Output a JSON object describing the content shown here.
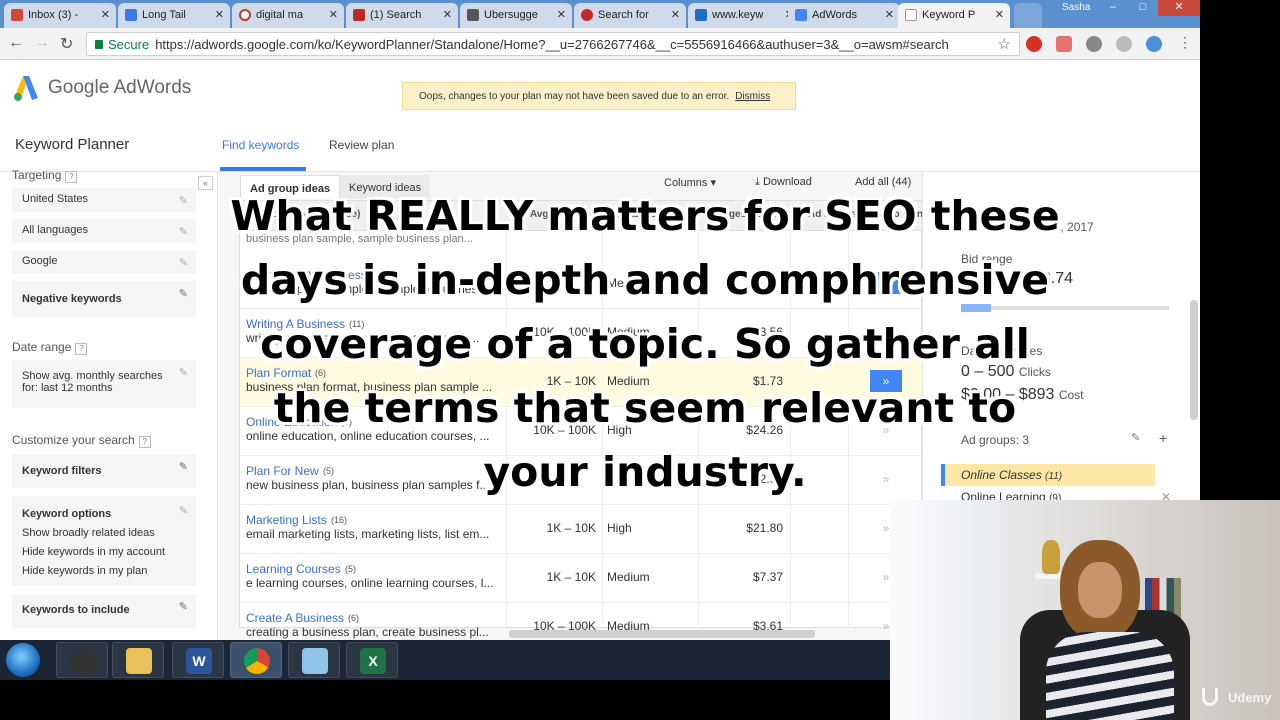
{
  "browser": {
    "tabs": [
      {
        "label": "Inbox (3) -",
        "color": "#d44638"
      },
      {
        "label": "Long Tail",
        "color": "#3b78e7"
      },
      {
        "label": "digital ma",
        "color": "#c33"
      },
      {
        "label": "(1) Search",
        "color": "#b92b27"
      },
      {
        "label": "Ubersugge",
        "color": "#555"
      },
      {
        "label": "Search for",
        "color": "#c62828"
      },
      {
        "label": "www.keyw",
        "color": "#1e6fc1"
      },
      {
        "label": "AdWords",
        "color": "#4285f4"
      },
      {
        "label": "Keyword P",
        "color": "#aaa"
      }
    ],
    "user": "Sasha",
    "url_secure": "Secure",
    "url": "https://adwords.google.com/ko/KeywordPlanner/Standalone/Home?__u=2766267746&__c=5556916466&authuser=3&__o=awsm#search"
  },
  "page": {
    "logo_text": "Google AdWords",
    "alert_text": "Oops, changes to your plan may not have been saved due to an error.",
    "alert_link": "Dismiss",
    "title": "Keyword Planner",
    "tabs": {
      "find": "Find keywords",
      "review": "Review plan"
    }
  },
  "sidebar": {
    "targeting_label": "Targeting",
    "targeting": [
      "United States",
      "All languages",
      "Google",
      "Negative keywords"
    ],
    "date_range_label": "Date range",
    "date_range_value_1": "Show avg. monthly searches",
    "date_range_value_2": "for: last 12 months",
    "customize_label": "Customize your search",
    "keyword_filters": "Keyword filters",
    "keyword_options": "Keyword options",
    "keyword_options_items": [
      "Show broadly related ideas",
      "Hide keywords in my account",
      "Hide keywords in my plan"
    ],
    "keywords_to_include": "Keywords to include"
  },
  "results": {
    "tabs": {
      "adgroup": "Ad group ideas",
      "keyword": "Keyword ideas"
    },
    "columns_btn": "Columns",
    "download_btn": "Download",
    "add_all_btn": "Add all (44)",
    "headers": {
      "group": "Ad group (by relevance)",
      "searches": "Avg. monthly searches",
      "competition": "Competition",
      "bid": "Suggested bid",
      "share": "Ad impr. share",
      "add": "Add to plan"
    },
    "top_partial": "business plan sample, sample business plan...",
    "rows": [
      {
        "name": "Examples Of Business",
        "count": "(5)",
        "keywords": "business plan examples, sample of business...",
        "volume": "",
        "competition": "Medium",
        "bid": "",
        "active": true,
        "highlight": false
      },
      {
        "name": "Writing A Business",
        "count": "(11)",
        "keywords": "writing a business plan, writing a business...",
        "volume": "10K – 100K",
        "competition": "Medium",
        "bid": "$3.56",
        "active": false,
        "highlight": false
      },
      {
        "name": "Plan Format",
        "count": "(6)",
        "keywords": "business plan format, business plan sample ...",
        "volume": "1K – 10K",
        "competition": "Medium",
        "bid": "$1.73",
        "active": true,
        "highlight": true
      },
      {
        "name": "Online Education",
        "count": "(9)",
        "keywords": "online education, online education courses, ...",
        "volume": "10K – 100K",
        "competition": "High",
        "bid": "$24.26",
        "active": false,
        "highlight": false
      },
      {
        "name": "Plan For New",
        "count": "(5)",
        "keywords": "new business plan, business plan samples f...",
        "volume": "",
        "competition": "",
        "bid": "$2.99",
        "active": false,
        "highlight": false
      },
      {
        "name": "Marketing Lists",
        "count": "(16)",
        "keywords": "email marketing lists, marketing lists, list em...",
        "volume": "1K – 10K",
        "competition": "High",
        "bid": "$21.80",
        "active": false,
        "highlight": false
      },
      {
        "name": "Learning Courses",
        "count": "(5)",
        "keywords": "e learning courses, online learning courses, l...",
        "volume": "1K – 10K",
        "competition": "Medium",
        "bid": "$7.37",
        "active": false,
        "highlight": false
      },
      {
        "name": "Create A Business",
        "count": "(6)",
        "keywords": "creating a business plan, create business pl...",
        "volume": "10K – 100K",
        "competition": "Medium",
        "bid": "$3.61",
        "active": false,
        "highlight": false
      }
    ]
  },
  "right_panel": {
    "date": "14, 2017",
    "bid_range_label": "Bid range",
    "bid_value": "$2.74",
    "daily_label": "Daily estimates",
    "clicks": "0 – 500",
    "clicks_label": "Clicks",
    "cost": "$0.00 – $893",
    "cost_label": "Cost",
    "ad_groups": "Ad groups: 3",
    "group_1": "Online Classes",
    "group_1_count": "(11)",
    "group_2": "Online Learning",
    "group_2_count": "(9)"
  },
  "caption": "What REALLY matters for SEO these days is in-depth and comphrensive coverage of a topic. So gather all the terms that seem relevant to your industry.",
  "watermark": "Udemy",
  "taskbar": {
    "apps": [
      "media-player-icon",
      "file-explorer-icon",
      "word-icon",
      "chrome-icon",
      "notepad-icon",
      "excel-icon"
    ]
  }
}
